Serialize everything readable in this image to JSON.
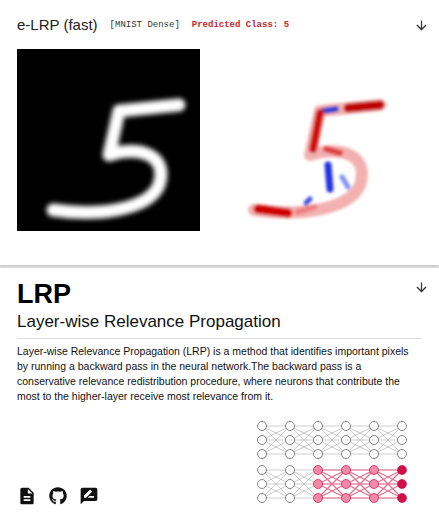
{
  "explainer": {
    "title": "e-LRP (fast)",
    "model": "[MNIST Dense]",
    "prediction": "Predicted Class: 5"
  },
  "method": {
    "title": "LRP",
    "subtitle": "Layer-wise Relevance Propagation",
    "description": "Layer-wise Relevance Propagation (LRP) is a method that identifies important pixels by running a backward pass in the neural network.The backward pass is a conservative relevance redistribution procedure, where neurons that contribute the most to the higher-layer receive most relevance from it."
  }
}
